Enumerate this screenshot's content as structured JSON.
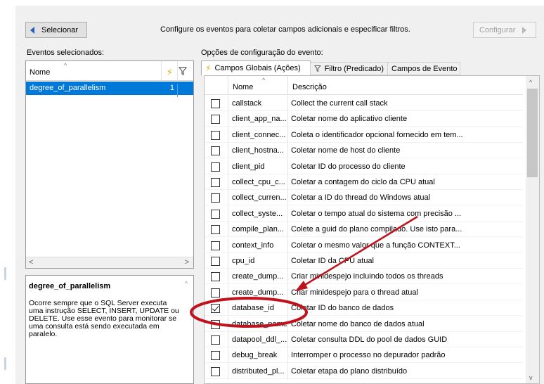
{
  "toolbar": {
    "select_label": "Selecionar",
    "hint": "Configure os eventos para coletar campos adicionais e especificar filtros.",
    "configure_label": "Configurar"
  },
  "selected_events": {
    "label": "Eventos selecionados:",
    "col_name": "Nome",
    "rows": [
      {
        "name": "degree_of_parallelism",
        "count": "1"
      }
    ]
  },
  "description": {
    "title": "degree_of_parallelism",
    "text": "Ocorre sempre que o SQL Server executa uma instrução SELECT, INSERT, UPDATE ou DELETE. Use esse evento para monitorar se uma consulta está sendo executada em paralelo."
  },
  "options": {
    "label": "Opções de configuração do evento:",
    "tabs": [
      "Campos Globais (Ações)",
      "Filtro (Predicado)",
      "Campos de Evento"
    ]
  },
  "fields": {
    "col_name": "Nome",
    "col_desc": "Descrição",
    "rows": [
      {
        "name": "callstack",
        "desc": "Collect the current call stack",
        "checked": false
      },
      {
        "name": "client_app_na...",
        "desc": "Coletar nome do aplicativo cliente",
        "checked": false
      },
      {
        "name": "client_connec...",
        "desc": "Coleta o identificador opcional fornecido em tem...",
        "checked": false
      },
      {
        "name": "client_hostna...",
        "desc": "Coletar nome de host do cliente",
        "checked": false
      },
      {
        "name": "client_pid",
        "desc": "Coletar ID do processo do cliente",
        "checked": false
      },
      {
        "name": "collect_cpu_c...",
        "desc": "Coletar a contagem do ciclo da CPU atual",
        "checked": false
      },
      {
        "name": "collect_curren...",
        "desc": "Coletar a ID do thread do Windows atual",
        "checked": false
      },
      {
        "name": "collect_syste...",
        "desc": "Coletar o tempo atual do sistema com precisão ...",
        "checked": false
      },
      {
        "name": "compile_plan...",
        "desc": "Colete a guid do plano compilado. Use isto para...",
        "checked": false
      },
      {
        "name": "context_info",
        "desc": "Coletar o mesmo valor que a função CONTEXT...",
        "checked": false
      },
      {
        "name": "cpu_id",
        "desc": "Coletar ID da CPU atual",
        "checked": false
      },
      {
        "name": "create_dump...",
        "desc": "Criar minidespejo incluindo todos os threads",
        "checked": false
      },
      {
        "name": "create_dump...",
        "desc": "Criar minidespejo para o thread atual",
        "checked": false
      },
      {
        "name": "database_id",
        "desc": "Coletar ID do banco de dados",
        "checked": true
      },
      {
        "name": "database_name",
        "desc": "Coletar nome do banco de dados atual",
        "checked": false
      },
      {
        "name": "datapool_ddl_...",
        "desc": "Coletar consulta DDL do pool de dados GUID",
        "checked": false
      },
      {
        "name": "debug_break",
        "desc": "Interromper o processo no depurador padrão",
        "checked": false
      },
      {
        "name": "distributed_pl...",
        "desc": "Coletar etapa do plano distribuído",
        "checked": false
      }
    ]
  },
  "colors": {
    "selection": "#0078d7",
    "annotation": "#c0121c"
  }
}
